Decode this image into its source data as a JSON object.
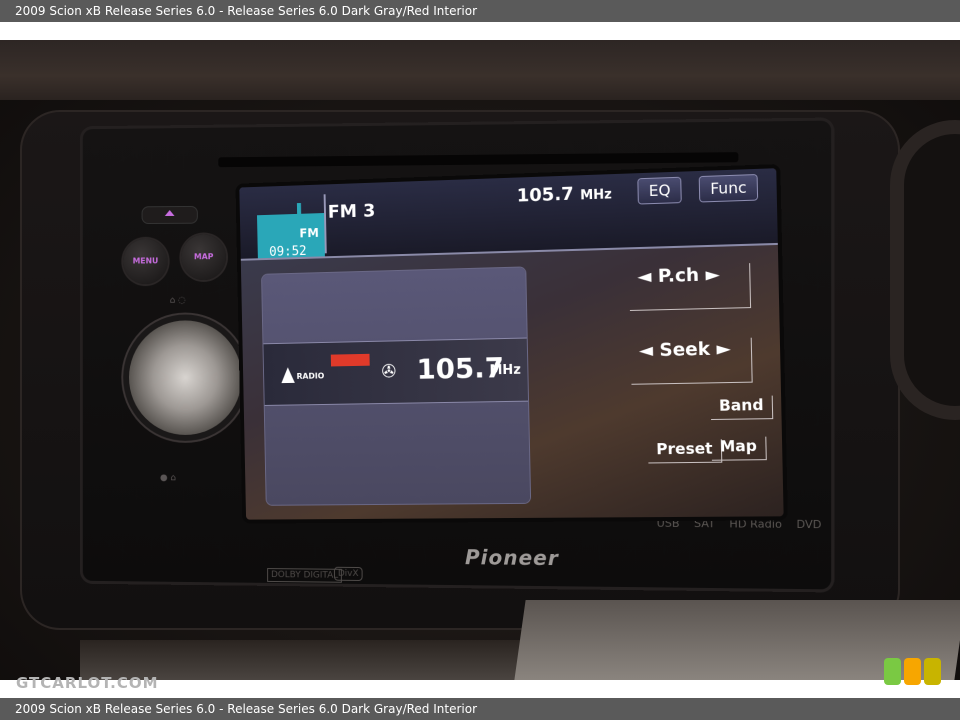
{
  "caption": "2009 Scion xB Release Series 6.0 - Release Series 6.0 Dark Gray/Red Interior",
  "watermark": "GTCARLOT.COM",
  "head_unit": {
    "brand": "Pioneer",
    "buttons": {
      "menu": "MENU",
      "map": "MAP"
    },
    "logos": [
      "USB",
      "SAT",
      "HD Radio",
      "DVD"
    ],
    "dolby": "DOLBY DIGITAL",
    "divx": "DivX"
  },
  "screen": {
    "band": "FM",
    "clock": "09:52",
    "preset": "FM 3",
    "frequency_top": "105.7",
    "frequency_unit": "MHz",
    "top_buttons": {
      "eq": "EQ",
      "func": "Func"
    },
    "radio_label": "RADIO",
    "frequency_main": "105.7",
    "soft_buttons": {
      "pch": "◄ P.ch ►",
      "seek": "◄ Seek ►",
      "band": "Band",
      "preset": "Preset",
      "map": "Map"
    }
  },
  "colors": {
    "accent": "#c86de0",
    "band_icon": "#2aa7b8",
    "badge": "#e03a2a"
  },
  "badge_colors": [
    "#7ac943",
    "#f7a600",
    "#c8b400"
  ]
}
